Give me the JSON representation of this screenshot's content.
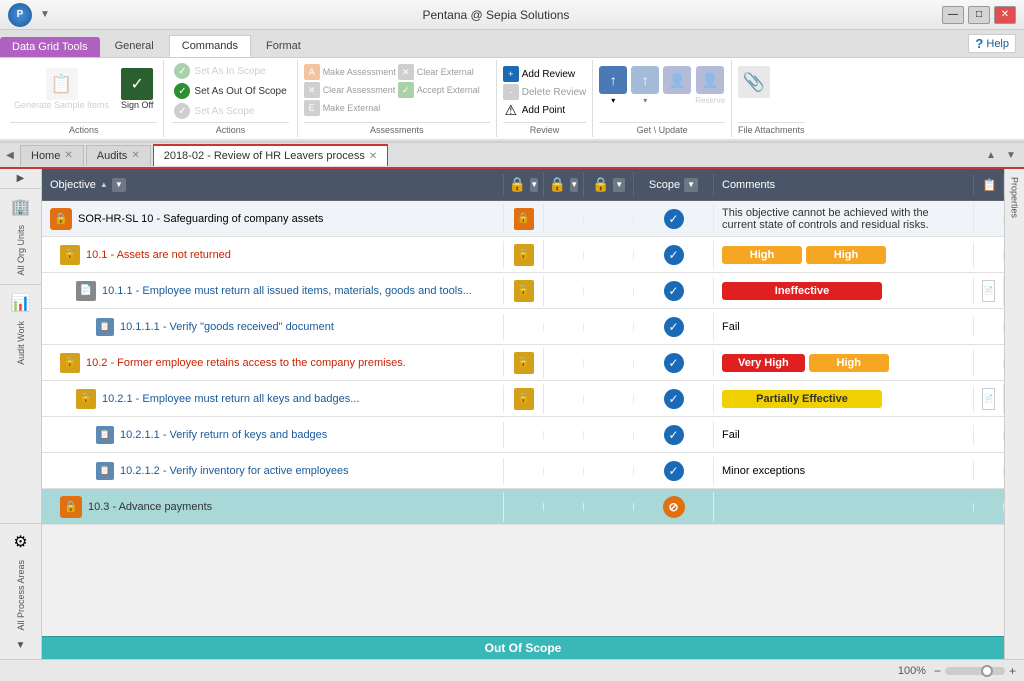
{
  "titleBar": {
    "appName": "Pentana @ Sepia Solutions",
    "minimize": "—",
    "maximize": "□",
    "close": "✕"
  },
  "ribbon": {
    "tabs": [
      {
        "label": "Data Grid Tools",
        "active": false,
        "highlight": true
      },
      {
        "label": "General",
        "active": false
      },
      {
        "label": "Commands",
        "active": true
      },
      {
        "label": "Format",
        "active": false
      }
    ],
    "groups": {
      "actions1": {
        "label": "Actions",
        "generateLabel": "Generate\nSample Items",
        "signOffLabel": "Sign\nOff"
      },
      "actions2": {
        "label": "Actions",
        "setInScope": "Set As In Scope",
        "setOutOfScope": "Set As Out Of Scope",
        "setAsScope": "Set As Scope"
      },
      "assessments": {
        "label": "Assessments",
        "makeAssessment": "Make Assessment",
        "clearAssessment": "Clear Assessment",
        "makeExternal": "Make External",
        "clearExternal": "Clear External",
        "acceptExternal": "Accept External"
      },
      "review": {
        "label": "Review",
        "addReview": "Add Review",
        "deleteReview": "Delete Review",
        "addPoint": "Add Point"
      },
      "getUpdate": {
        "label": "Get \\ Update"
      },
      "fileAttachments": {
        "label": "File Attachments"
      }
    },
    "help": "Help"
  },
  "navTabs": [
    {
      "label": "Home",
      "closable": true,
      "active": false
    },
    {
      "label": "Audits",
      "closable": true,
      "active": false
    },
    {
      "label": "2018-02 - Review of HR Leavers process",
      "closable": true,
      "active": true
    }
  ],
  "gridColumns": {
    "objective": "Objective",
    "col2": "🔒",
    "col3": "🔒",
    "col4": "🔒",
    "scope": "Scope",
    "comments": "Comments",
    "col7": ""
  },
  "gridRows": [
    {
      "id": "sor",
      "level": 0,
      "icon": "shield-orange",
      "text": "SOR-HR-SL 10 - Safeguarding of company assets",
      "hasIcon2": true,
      "scopeIcon": "check-blue",
      "comments": "This objective cannot be achieved with the current state of controls and residual risks.",
      "badge1": null,
      "badge2": null,
      "docIcon": false
    },
    {
      "id": "10.1",
      "level": 1,
      "icon": "shield-gold",
      "text": "10.1 - Assets are not returned",
      "hasIcon2": true,
      "scopeIcon": "check-blue",
      "badge1": {
        "text": "High",
        "type": "high"
      },
      "badge2": {
        "text": "High",
        "type": "high"
      },
      "comments": "",
      "docIcon": false
    },
    {
      "id": "10.1.1",
      "level": 2,
      "icon": "doc-blue",
      "text": "10.1.1 - Employee must return all issued items, materials, goods and tools...",
      "hasIcon2": true,
      "scopeIcon": "check-blue",
      "badge1": {
        "text": "Ineffective",
        "type": "ineffective"
      },
      "badge2": null,
      "comments": "",
      "docIcon": true
    },
    {
      "id": "10.1.1.1",
      "level": 3,
      "icon": "doc-small",
      "text": "10.1.1.1 - Verify \"goods received\" document",
      "hasIcon2": false,
      "scopeIcon": "check-blue",
      "badge1": null,
      "badge2": null,
      "comments": "Fail",
      "docIcon": false
    },
    {
      "id": "10.2",
      "level": 1,
      "icon": "shield-gold",
      "text": "10.2 - Former employee retains access to the company premises.",
      "hasIcon2": true,
      "scopeIcon": "check-blue",
      "badge1": {
        "text": "Very High",
        "type": "very-high"
      },
      "badge2": {
        "text": "High",
        "type": "high"
      },
      "comments": "",
      "docIcon": false
    },
    {
      "id": "10.2.1",
      "level": 2,
      "icon": "shield-gold",
      "text": "10.2.1 - Employee must return all keys and badges...",
      "hasIcon2": true,
      "scopeIcon": "check-blue",
      "badge1": {
        "text": "Partially Effective",
        "type": "partially-effective"
      },
      "badge2": null,
      "comments": "",
      "docIcon": true
    },
    {
      "id": "10.2.1.1",
      "level": 3,
      "icon": "doc-small",
      "text": "10.2.1.1 - Verify return of keys and badges",
      "hasIcon2": false,
      "scopeIcon": "check-blue",
      "badge1": null,
      "badge2": null,
      "comments": "Fail",
      "docIcon": false
    },
    {
      "id": "10.2.1.2",
      "level": 3,
      "icon": "doc-small",
      "text": "10.2.1.2 - Verify inventory for active employees",
      "hasIcon2": false,
      "scopeIcon": "check-blue",
      "badge1": null,
      "badge2": null,
      "comments": "Minor exceptions",
      "docIcon": false
    },
    {
      "id": "10.3",
      "level": 1,
      "icon": "shield-orange",
      "text": "10.3 - Advance payments",
      "hasIcon2": false,
      "scopeIcon": "blocked",
      "badge1": null,
      "badge2": null,
      "comments": "",
      "docIcon": false,
      "outOfScope": true
    }
  ],
  "outOfScopeBanner": "Out Of Scope",
  "statusBar": {
    "zoom": "100%"
  },
  "sidebar": {
    "allOrgUnits": "All Org Units",
    "auditWork": "Audit Work",
    "allProcessAreas": "All Process Areas"
  }
}
